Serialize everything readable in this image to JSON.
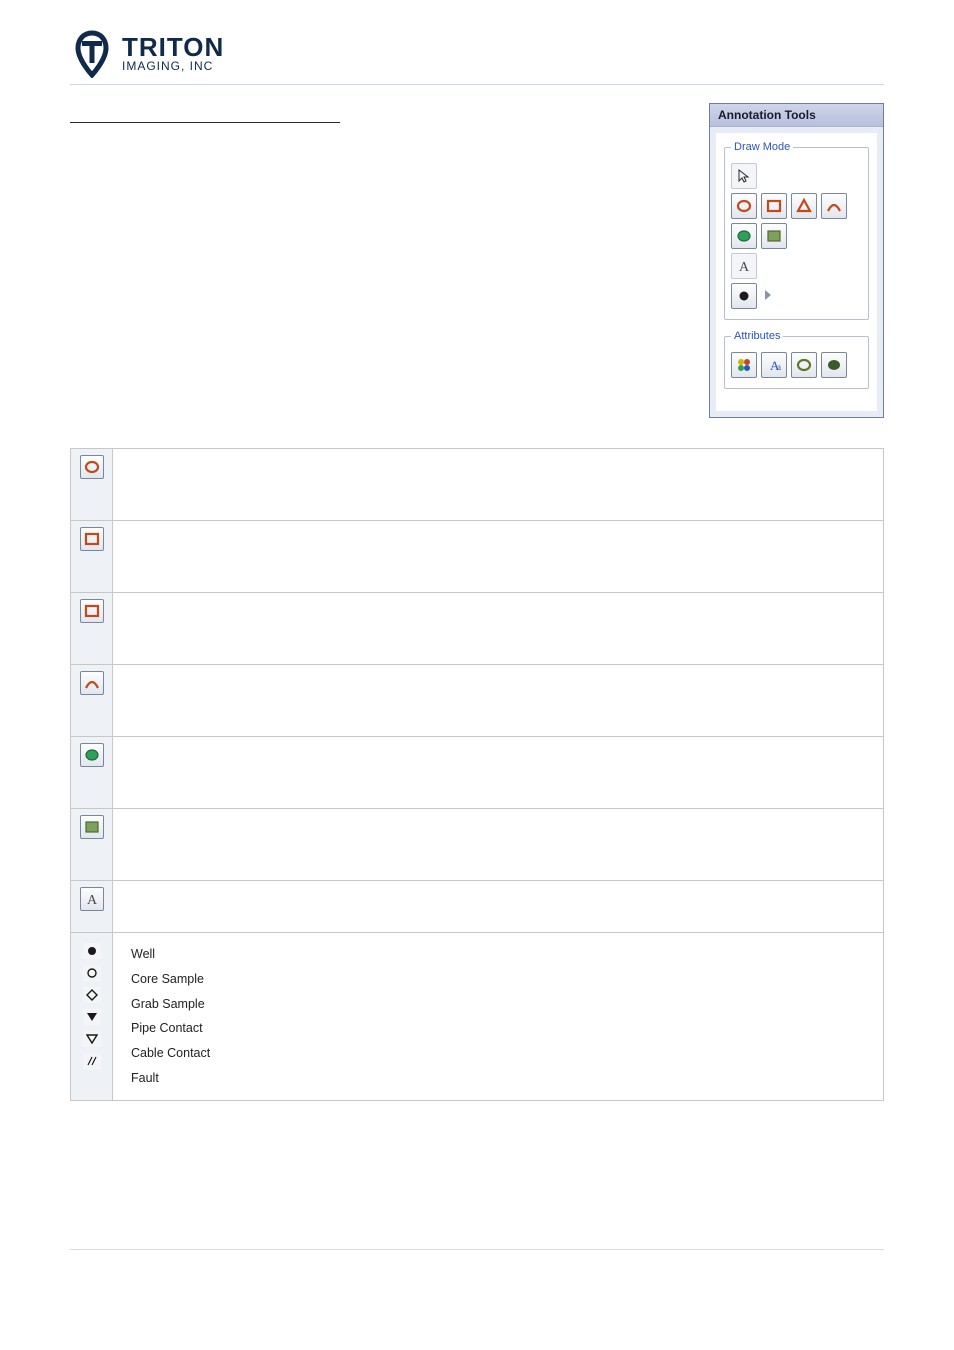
{
  "logo": {
    "name": "TRITON",
    "sub": "IMAGING, INC"
  },
  "panel": {
    "title": "Annotation Tools",
    "group_draw": "Draw Mode",
    "group_attr": "Attributes"
  },
  "rows": [
    {
      "desc": ""
    },
    {
      "desc": ""
    },
    {
      "desc": ""
    },
    {
      "desc": ""
    },
    {
      "desc": ""
    },
    {
      "desc": ""
    },
    {
      "desc": ""
    }
  ],
  "symbols": [
    {
      "label": "Well"
    },
    {
      "label": "Core Sample"
    },
    {
      "label": "Grab Sample"
    },
    {
      "label": "Pipe Contact"
    },
    {
      "label": "Cable Contact"
    },
    {
      "label": "Fault"
    }
  ]
}
